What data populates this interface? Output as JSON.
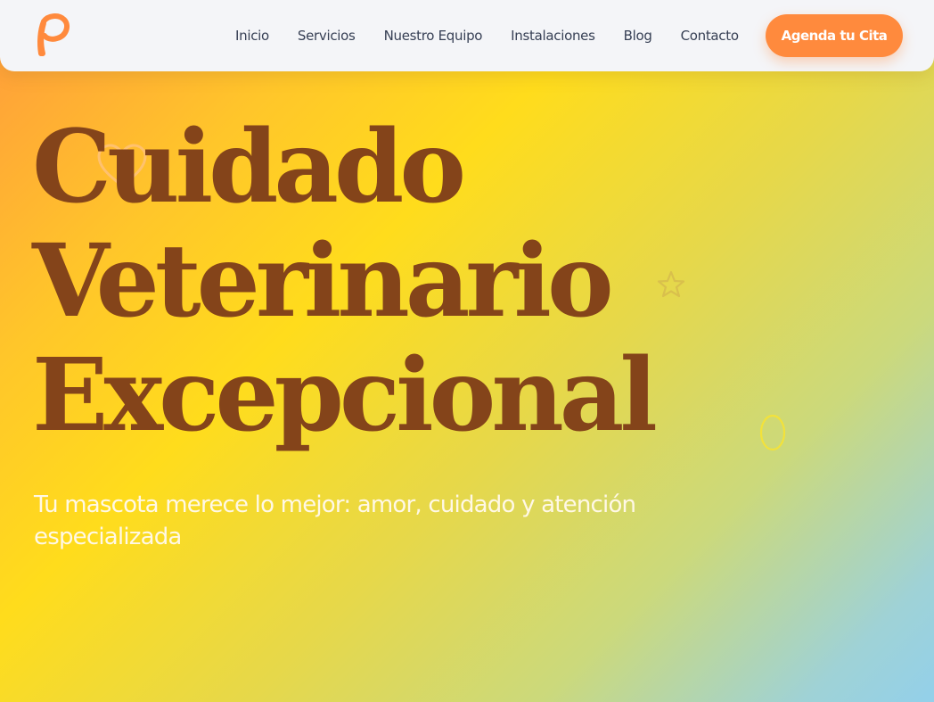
{
  "brand": {
    "logo_letter": "P",
    "accent_color": "#ff8a3d"
  },
  "nav": {
    "links": [
      "Inicio",
      "Servicios",
      "Nuestro Equipo",
      "Instalaciones",
      "Blog",
      "Contacto"
    ],
    "cta_label": "Agenda tu Cita"
  },
  "hero": {
    "title_lines": [
      "Cuidado",
      "Veterinario",
      "Excepcional"
    ],
    "subtitle": "Tu mascota merece lo mejor: amor, cuidado y atención especializada",
    "title_color": "#84441a",
    "decorations": [
      "heart-outline-icon",
      "star-outline-icon",
      "oval-outline-icon"
    ]
  }
}
